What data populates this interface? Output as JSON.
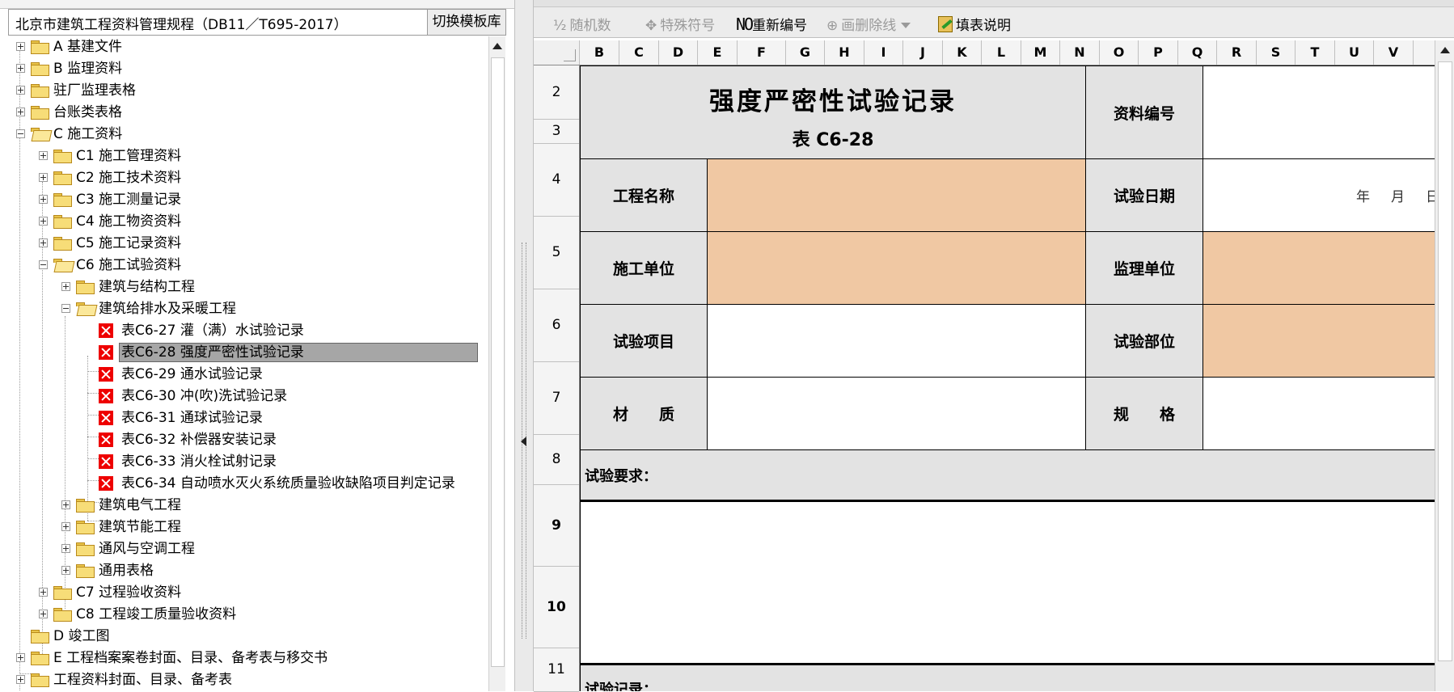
{
  "left_panel": {
    "spec_title": "北京市建筑工程资料管理规程（DB11／T695-2017）",
    "switch_button": "切换模板库",
    "tree": [
      {
        "label": "A 基建文件"
      },
      {
        "label": "B 监理资料"
      },
      {
        "label": "驻厂监理表格"
      },
      {
        "label": "台账类表格"
      },
      {
        "label": "C 施工资料"
      },
      {
        "label": "C1 施工管理资料"
      },
      {
        "label": "C2 施工技术资料"
      },
      {
        "label": "C3 施工测量记录"
      },
      {
        "label": "C4 施工物资资料"
      },
      {
        "label": "C5 施工记录资料"
      },
      {
        "label": "C6 施工试验资料"
      },
      {
        "label": "建筑与结构工程"
      },
      {
        "label": "建筑给排水及采暖工程"
      },
      {
        "label": "表C6-27 灌（满）水试验记录"
      },
      {
        "label": "表C6-28 强度严密性试验记录"
      },
      {
        "label": "表C6-29 通水试验记录"
      },
      {
        "label": "表C6-30 冲(吹)洗试验记录"
      },
      {
        "label": "表C6-31 通球试验记录"
      },
      {
        "label": "表C6-32 补偿器安装记录"
      },
      {
        "label": "表C6-33 消火栓试射记录"
      },
      {
        "label": "表C6-34 自动喷水灭火系统质量验收缺陷项目判定记录"
      },
      {
        "label": "建筑电气工程"
      },
      {
        "label": "建筑节能工程"
      },
      {
        "label": "通风与空调工程"
      },
      {
        "label": "通用表格"
      },
      {
        "label": "C7 过程验收资料"
      },
      {
        "label": "C8 工程竣工质量验收资料"
      },
      {
        "label": "D 竣工图"
      },
      {
        "label": "E 工程档案案卷封面、目录、备考表与移交书"
      },
      {
        "label": "工程资料封面、目录、备考表"
      }
    ]
  },
  "toolbar": {
    "random": "随机数",
    "special": "特殊符号",
    "renumber_icon": "NO",
    "renumber": "重新编号",
    "strike": "画删除线",
    "notes": "填表说明"
  },
  "sheet": {
    "columns": [
      "B",
      "C",
      "D",
      "E",
      "F",
      "G",
      "H",
      "I",
      "J",
      "K",
      "L",
      "M",
      "N",
      "O",
      "P",
      "Q",
      "R",
      "S",
      "T",
      "U",
      "V"
    ],
    "rows": [
      "2",
      "3",
      "4",
      "5",
      "6",
      "7",
      "8",
      "9",
      "10",
      "11"
    ],
    "form": {
      "title": "强度严密性试验记录",
      "table_no": "表 C6-28",
      "doc_no_label": "资料编号",
      "project_name_label": "工程名称",
      "test_date_label": "试验日期",
      "date_year": "年",
      "date_month": "月",
      "date_day": "日",
      "construction_unit_label": "施工单位",
      "supervision_unit_label": "监理单位",
      "test_item_label": "试验项目",
      "test_location_label": "试验部位",
      "material_label": "材　　质",
      "spec_label": "规　　格",
      "requirements_label": "试验要求：",
      "record_label": "试验记录："
    }
  },
  "colors": {
    "peach": "#f0c8a3",
    "gray": "#e3e3e3",
    "doc_icon": "#e00000",
    "folder": "#f7dd78"
  }
}
